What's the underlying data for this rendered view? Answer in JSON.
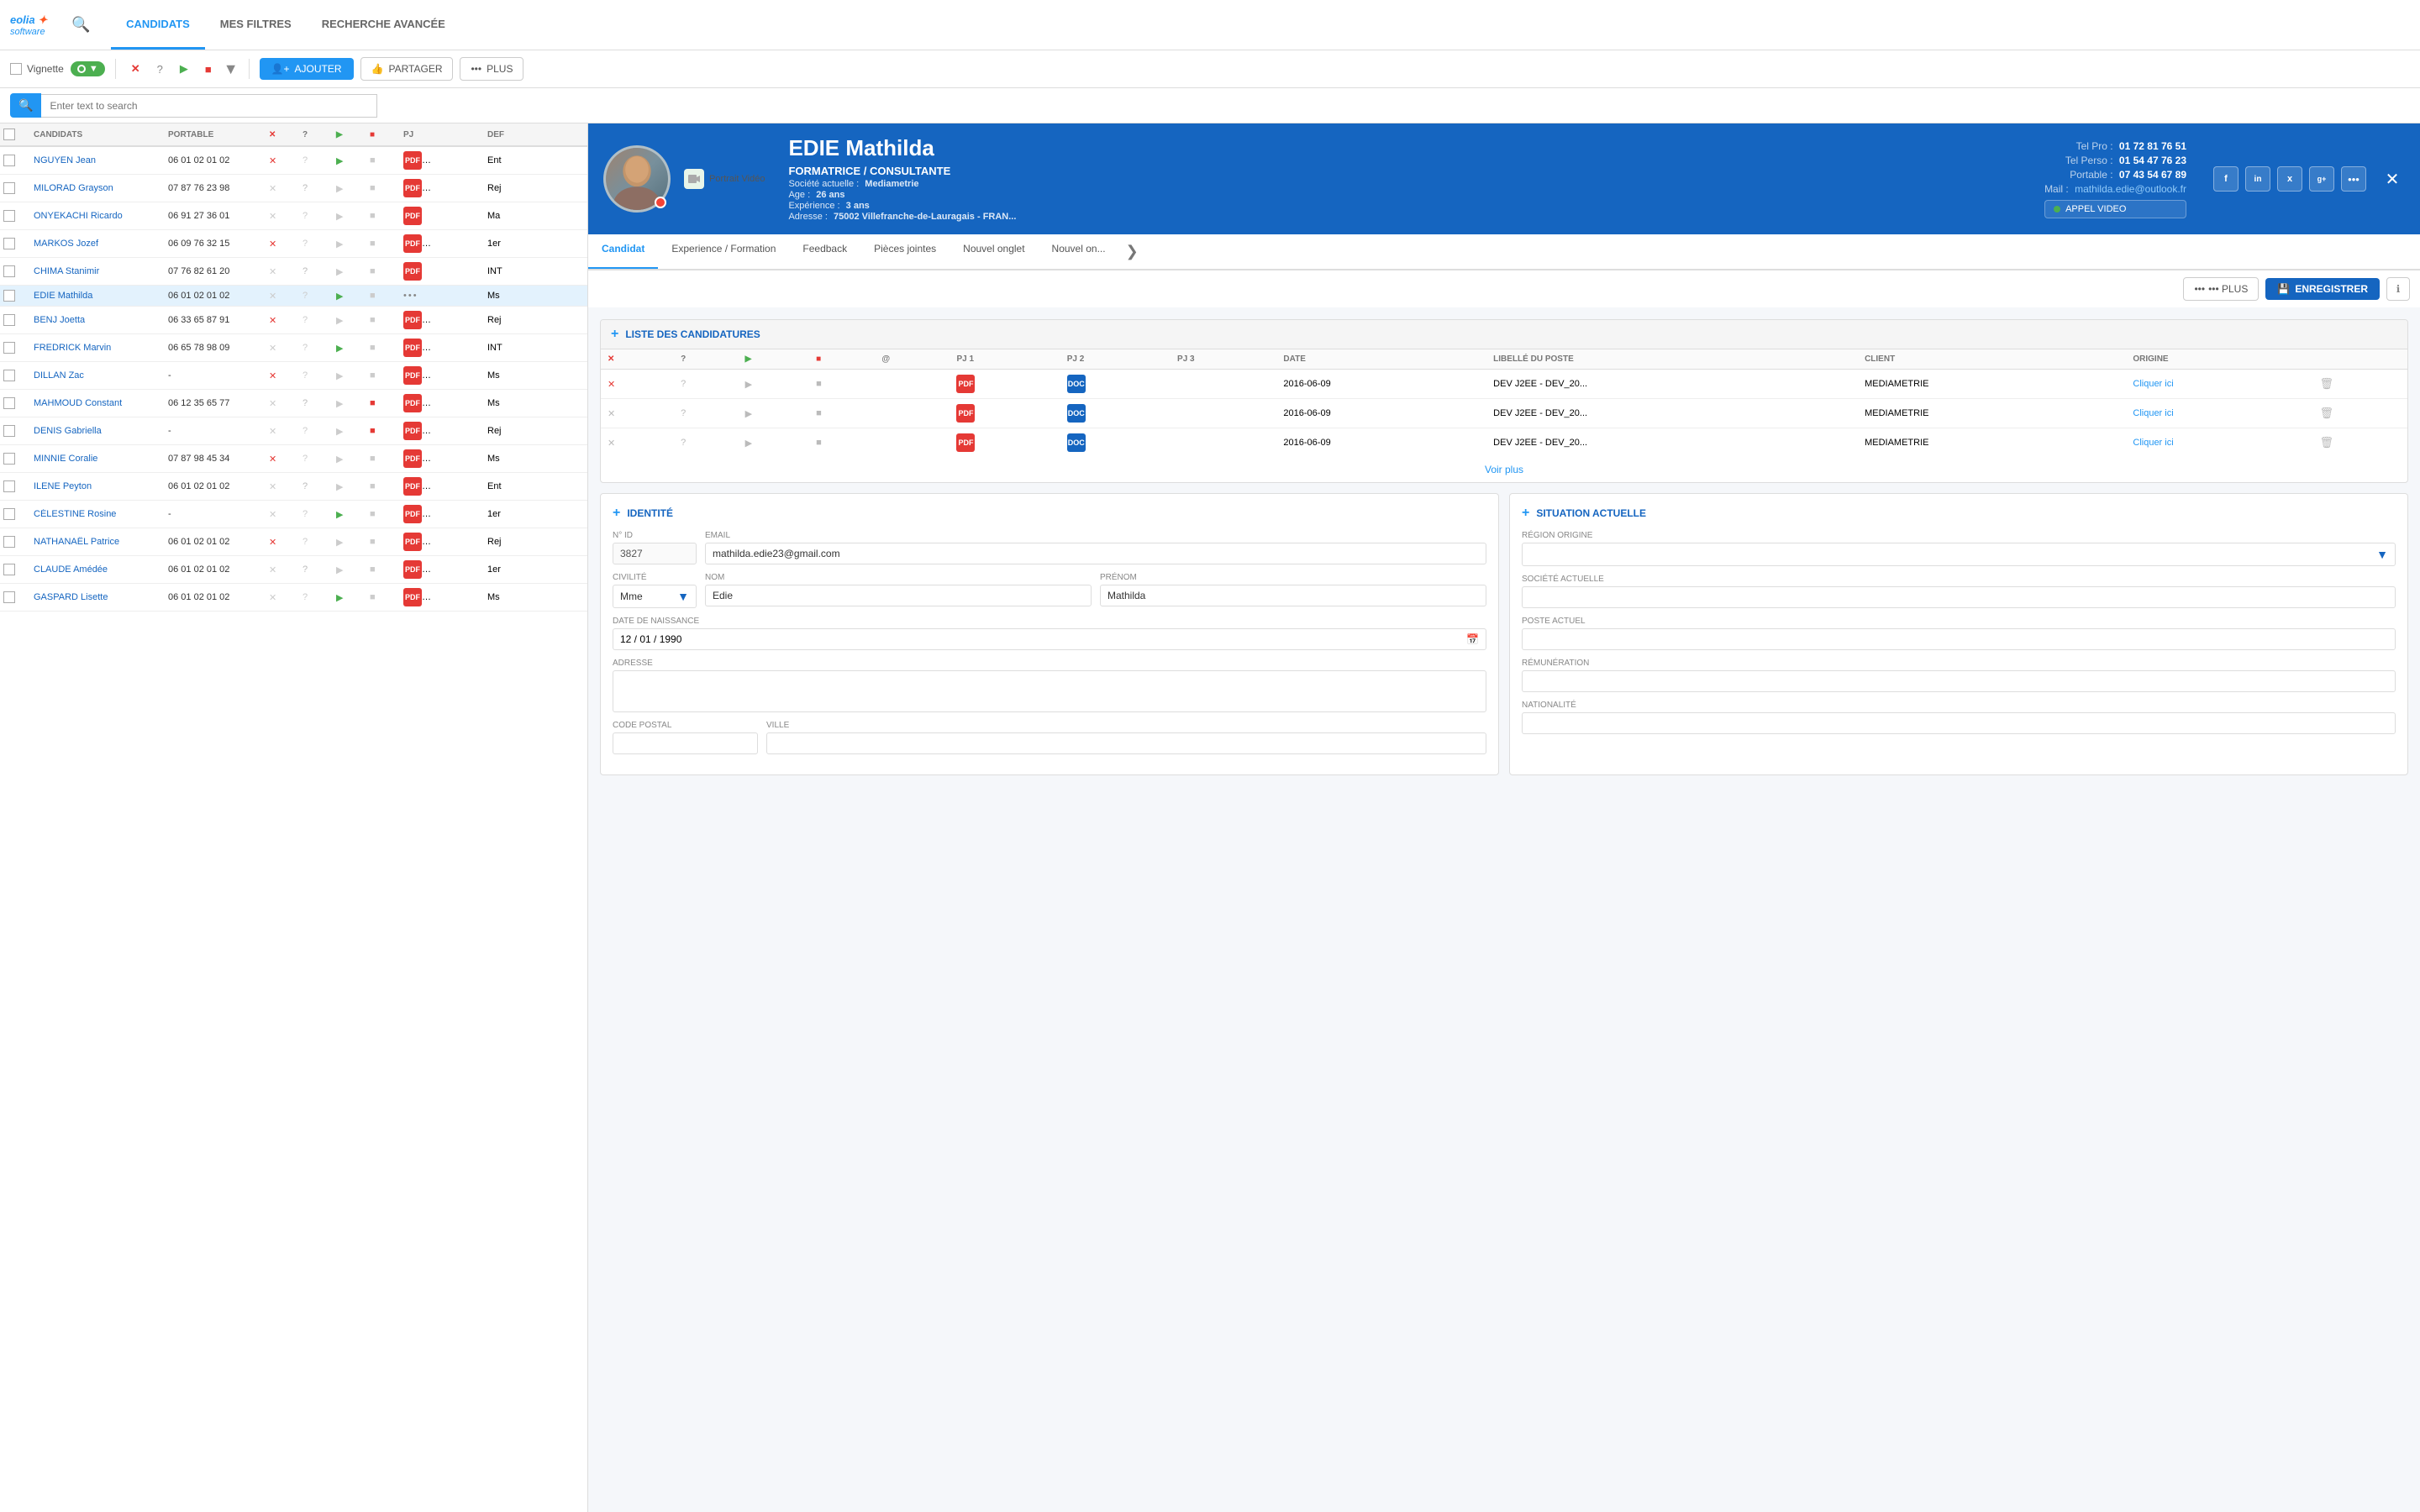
{
  "logo": {
    "line1": "eolia",
    "line2": "software"
  },
  "header": {
    "nav": [
      {
        "id": "candidats",
        "label": "CANDIDATS",
        "active": true
      },
      {
        "id": "mes-filtres",
        "label": "MES FILTRES",
        "active": false
      },
      {
        "id": "recherche-avancee",
        "label": "RECHERCHE AVANCÉE",
        "active": false
      }
    ]
  },
  "toolbar": {
    "vignette_label": "Vignette",
    "ajouter_label": "AJOUTER",
    "partager_label": "PARTAGER",
    "plus_label": "PLUS"
  },
  "search": {
    "placeholder": "Enter text to search"
  },
  "table": {
    "headers": [
      "",
      "CANDIDATS",
      "PORTABLE",
      "✕",
      "?",
      "▶",
      "■",
      "PJ",
      "DEF"
    ],
    "rows": [
      {
        "name": "NGUYEN Jean",
        "phone": "06 01 02 01 02",
        "x": true,
        "q": false,
        "play": true,
        "stop": false,
        "note": "",
        "def": "Ent"
      },
      {
        "name": "MILORAD Grayson",
        "phone": "07 87 76 23 98",
        "x": false,
        "q": true,
        "play": false,
        "stop": false,
        "note": "",
        "def": "Rej"
      },
      {
        "name": "ONYEKACHI Ricardo",
        "phone": "06 91 27 36 01",
        "x": false,
        "q": true,
        "play": false,
        "stop": false,
        "note": "",
        "def": "Ma"
      },
      {
        "name": "MARKOS Jozef",
        "phone": "06 09 76 32 15",
        "x": true,
        "q": false,
        "play": false,
        "stop": false,
        "note": "",
        "def": "1er"
      },
      {
        "name": "CHIMA Stanimir",
        "phone": "07 76 82 61 20",
        "x": false,
        "q": true,
        "play": false,
        "stop": false,
        "note": "",
        "def": "INT"
      },
      {
        "name": "EDIE Mathilda",
        "phone": "06 01 02 01 02",
        "x": false,
        "q": false,
        "play": true,
        "stop": false,
        "note": "",
        "def": "Ms",
        "active": true
      },
      {
        "name": "BENJ Joetta",
        "phone": "06 33 65 87 91",
        "x": true,
        "q": false,
        "play": false,
        "stop": false,
        "note": "",
        "def": "Rej"
      },
      {
        "name": "FREDRICK Marvin",
        "phone": "06 65 78 98 09",
        "x": false,
        "q": false,
        "play": true,
        "stop": false,
        "note": "",
        "def": "INT"
      },
      {
        "name": "DILLAN Zac",
        "phone": "-",
        "x": true,
        "q": false,
        "play": false,
        "stop": false,
        "note": "",
        "def": "Ms"
      },
      {
        "name": "MAHMOUD Constant",
        "phone": "06 12 35 65 77",
        "x": false,
        "q": true,
        "play": false,
        "stop": true,
        "note": "",
        "def": "Ms"
      },
      {
        "name": "DENIS Gabriella",
        "phone": "-",
        "x": false,
        "q": false,
        "play": false,
        "stop": true,
        "note": "",
        "def": "Rej"
      },
      {
        "name": "MINNIE Coralie",
        "phone": "07 87 98 45 34",
        "x": true,
        "q": false,
        "play": false,
        "stop": false,
        "note": "",
        "def": "Ms"
      },
      {
        "name": "ILENE Peyton",
        "phone": "06 01 02 01 02",
        "x": false,
        "q": true,
        "play": false,
        "stop": false,
        "note": "",
        "def": "Ent"
      },
      {
        "name": "CÉLESTINE Rosine",
        "phone": "-",
        "x": false,
        "q": false,
        "play": true,
        "stop": false,
        "note": "",
        "def": "1er"
      },
      {
        "name": "NATHANAËL Patrice",
        "phone": "06 01 02 01 02",
        "x": true,
        "q": false,
        "play": false,
        "stop": false,
        "note": "",
        "def": "Rej"
      },
      {
        "name": "CLAUDE Amédée",
        "phone": "06 01 02 01 02",
        "x": false,
        "q": true,
        "play": false,
        "stop": false,
        "note": "",
        "def": "1er"
      },
      {
        "name": "GASPARD Lisette",
        "phone": "06 01 02 01 02",
        "x": false,
        "q": false,
        "play": true,
        "stop": false,
        "note": "",
        "def": "Ms"
      }
    ]
  },
  "candidate": {
    "first_name": "Mathilda",
    "last_name": "EDIE",
    "full_name": "EDIE Mathilda",
    "title": "FORMATRICE / CONSULTANTE",
    "societe_label": "Société actuelle :",
    "societe_value": "Mediametrie",
    "age_label": "Age :",
    "age_value": "26 ans",
    "experience_label": "Expérience :",
    "experience_value": "3 ans",
    "adresse_label": "Adresse :",
    "adresse_value": "75002 Villefranche-de-Lauragais - FRAN...",
    "tel_pro_label": "Tel Pro :",
    "tel_pro_value": "01 72 81 76 51",
    "tel_perso_label": "Tel Perso :",
    "tel_perso_value": "01 54 47 76 23",
    "portable_label": "Portable :",
    "portable_value": "07 43 54 67 89",
    "mail_label": "Mail :",
    "mail_value": "mathilda.edie@outlook.fr",
    "video_btn": "APPEL VIDEO",
    "portrait_video_label": "Portrait Vidéo",
    "tabs": [
      {
        "id": "candidat",
        "label": "Candidat",
        "active": true
      },
      {
        "id": "experience-formation",
        "label": "Experience / Formation",
        "active": false
      },
      {
        "id": "feedback",
        "label": "Feedback",
        "active": false
      },
      {
        "id": "pieces-jointes",
        "label": "Pièces jointes",
        "active": false
      },
      {
        "id": "nouvel-onglet",
        "label": "Nouvel onglet",
        "active": false
      },
      {
        "id": "nouvel-on",
        "label": "Nouvel on...",
        "active": false
      }
    ],
    "action_plus": "••• PLUS",
    "action_enregistrer": "ENREGISTRER",
    "candidatures": {
      "section_title": "LISTE DES CANDIDATURES",
      "table_headers": [
        "✕",
        "?",
        "▶",
        "■",
        "@",
        "PJ 1",
        "PJ 2",
        "PJ 3",
        "DATE",
        "LIBELLÉ DU POSTE",
        "CLIENT",
        "ORIGINE"
      ],
      "rows": [
        {
          "date": "2016-06-09",
          "libelle": "DEV J2EE - DEV_20...",
          "client": "MEDIAMETRIE",
          "link": "Cliquer ici"
        },
        {
          "date": "2016-06-09",
          "libelle": "DEV J2EE - DEV_20...",
          "client": "MEDIAMETRIE",
          "link": "Cliquer ici"
        },
        {
          "date": "2016-06-09",
          "libelle": "DEV J2EE - DEV_20...",
          "client": "MEDIAMETRIE",
          "link": "Cliquer ici"
        }
      ],
      "voir_plus": "Voir plus"
    },
    "identite": {
      "section_title": "IDENTITÉ",
      "nid_label": "N° ID",
      "nid_value": "3827",
      "email_label": "Email",
      "email_value": "mathilda.edie23@gmail.com",
      "civilite_label": "Civilité",
      "civilite_value": "Mme",
      "nom_label": "Nom",
      "nom_value": "Edie",
      "prenom_label": "Prénom",
      "prenom_value": "Mathilda",
      "ddn_label": "Date de naissance",
      "ddn_value": "12 / 01 / 1990",
      "adresse_label": "Adresse",
      "adresse_value": "",
      "code_postal_label": "Code Postal",
      "code_postal_value": "",
      "ville_label": "Ville",
      "ville_value": ""
    },
    "situation": {
      "section_title": "SITUATION ACTUELLE",
      "region_label": "Région origine",
      "region_value": "",
      "societe_label": "Société actuelle",
      "societe_value": "",
      "poste_label": "Poste actuel",
      "poste_value": "",
      "remuneration_label": "Rémunération",
      "remuneration_value": "",
      "nationalite_label": "Nationalité",
      "nationalite_value": ""
    }
  },
  "icons": {
    "search": "🔍",
    "plus": "+",
    "close": "✕",
    "chevron_down": "▼",
    "chevron_right": "❯",
    "camera": "📷",
    "save": "💾",
    "info": "ℹ",
    "play": "▶",
    "stop": "■",
    "question": "?",
    "cross": "✕",
    "at": "@",
    "calendar": "📅",
    "video": "▶",
    "facebook": "f",
    "linkedin": "in",
    "xing": "x",
    "google": "g+",
    "more": "•••"
  }
}
